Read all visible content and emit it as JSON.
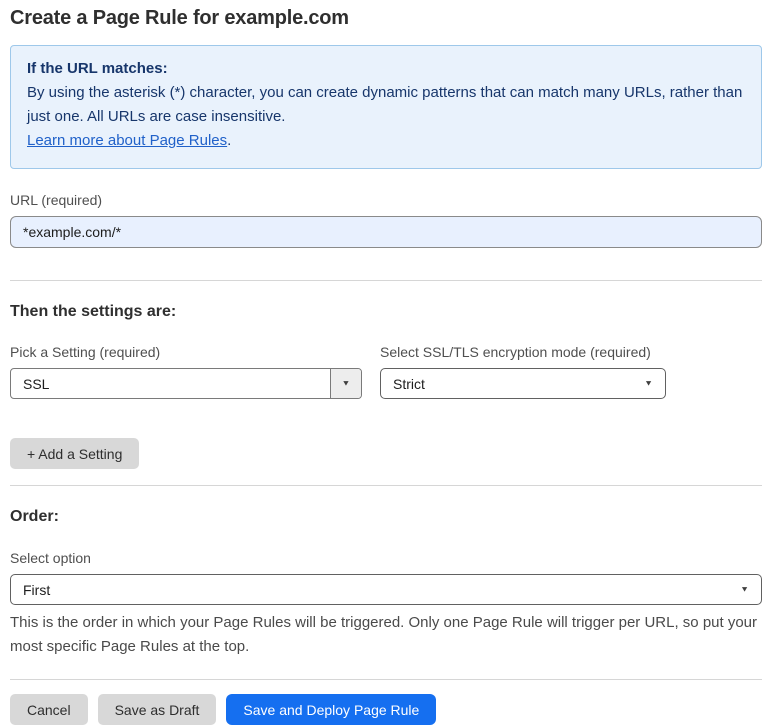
{
  "page": {
    "title": "Create a Page Rule for example.com"
  },
  "info_box": {
    "heading": "If the URL matches:",
    "body": "By using the asterisk (*) character, you can create dynamic patterns that can match many URLs, rather than just one. All URLs are case insensitive.",
    "link_label": "Learn more about Page Rules",
    "link_suffix": "."
  },
  "url_field": {
    "label": "URL (required)",
    "value": "*example.com/*"
  },
  "settings_section": {
    "heading": "Then the settings are:",
    "setting_picker": {
      "label": "Pick a Setting (required)",
      "value": "SSL"
    },
    "mode_picker": {
      "label": "Select SSL/TLS encryption mode (required)",
      "value": "Strict"
    },
    "add_setting_label": "+ Add a Setting"
  },
  "order_section": {
    "heading": "Order:",
    "select_label": "Select option",
    "value": "First",
    "help_text": "This is the order in which your Page Rules will be triggered. Only one Page Rule will trigger per URL, so put your most specific Page Rules at the top."
  },
  "footer": {
    "cancel_label": "Cancel",
    "save_draft_label": "Save as Draft",
    "save_deploy_label": "Save and Deploy Page Rule"
  },
  "icons": {
    "dropdown_arrow": "▼"
  },
  "colors": {
    "accent_blue": "#156ff0",
    "info_bg": "#e9f2fc",
    "info_border": "#9ec8ea",
    "info_text": "#17366b",
    "input_autofill_bg": "#e8f0fe",
    "button_gray": "#d8d8d8"
  }
}
